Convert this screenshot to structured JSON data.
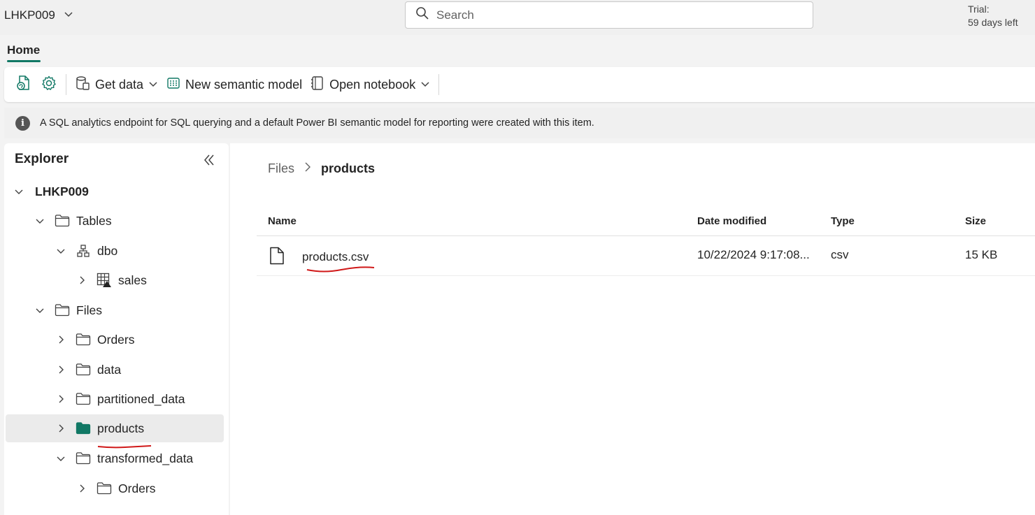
{
  "workspace": {
    "name": "LHKP009"
  },
  "search": {
    "placeholder": "Search"
  },
  "trial": {
    "line1": "Trial:",
    "line2": "59 days left"
  },
  "ribbon": {
    "active_tab": "Home"
  },
  "toolbar": {
    "get_data": "Get data",
    "new_semantic_model": "New semantic model",
    "open_notebook": "Open notebook"
  },
  "info": {
    "message": "A SQL analytics endpoint for SQL querying and a default Power BI semantic model for reporting were created with this item."
  },
  "explorer": {
    "title": "Explorer",
    "tree": {
      "root": "LHKP009",
      "tables": "Tables",
      "dbo": "dbo",
      "sales": "sales",
      "files": "Files",
      "orders": "Orders",
      "data": "data",
      "partitioned_data": "partitioned_data",
      "products": "products",
      "transformed_data": "transformed_data",
      "transformed_orders": "Orders"
    }
  },
  "breadcrumb": {
    "parent": "Files",
    "current": "products"
  },
  "file_table": {
    "headers": {
      "name": "Name",
      "date_modified": "Date modified",
      "type": "Type",
      "size": "Size"
    },
    "rows": [
      {
        "name": "products.csv",
        "date_modified": "10/22/2024 9:17:08...",
        "type": "csv",
        "size": "15 KB"
      }
    ]
  },
  "colors": {
    "accent": "#117865",
    "annotation": "#d01818"
  }
}
